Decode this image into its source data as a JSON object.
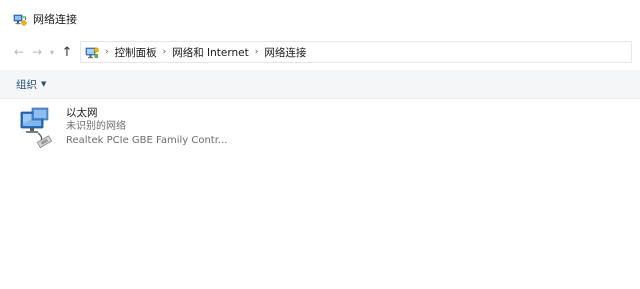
{
  "window": {
    "title": "网络连接"
  },
  "nav": {
    "back": "←",
    "forward": "→",
    "recent": "▾",
    "up": "↑",
    "separator": "›",
    "breadcrumbs": [
      "控制面板",
      "网络和 Internet",
      "网络连接"
    ]
  },
  "toolbar": {
    "organize_label": "组织",
    "organize_caret": "▼"
  },
  "adapters": [
    {
      "name": "以太网",
      "status": "未识别的网络",
      "device": "Realtek PCIe GBE Family Contr..."
    }
  ],
  "icons": {
    "title": "network-connections-icon",
    "address": "control-panel-icon",
    "adapter": "ethernet-adapter-icon"
  }
}
